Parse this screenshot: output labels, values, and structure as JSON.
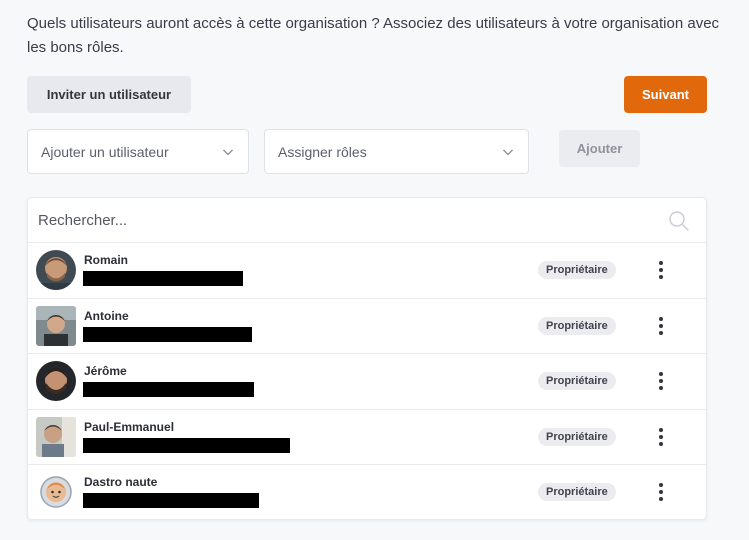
{
  "intro": {
    "text": "Quels utilisateurs auront accès à cette organisation ? Associez des utilisateurs à votre organisation avec les bons rôles."
  },
  "toolbar": {
    "invite_label": "Inviter un utilisateur",
    "next_label": "Suivant",
    "add_label": "Ajouter"
  },
  "selects": {
    "user_placeholder": "Ajouter un utilisateur",
    "roles_placeholder": "Assigner rôles"
  },
  "search": {
    "placeholder": "Rechercher..."
  },
  "users": [
    {
      "name": "Romain",
      "role": "Propriétaire",
      "avatar": "photo-romain"
    },
    {
      "name": "Antoine",
      "role": "Propriétaire",
      "avatar": "photo-antoine"
    },
    {
      "name": "Jérôme",
      "role": "Propriétaire",
      "avatar": "photo-jerome"
    },
    {
      "name": "Paul-Emmanuel",
      "role": "Propriétaire",
      "avatar": "photo-paul-emmanuel"
    },
    {
      "name": "Dastro naute",
      "role": "Propriétaire",
      "avatar": "astronaut-illustration"
    }
  ],
  "colors": {
    "accent": "#e2680c",
    "background": "#f7f8fa",
    "badge_bg": "#ececf0"
  }
}
